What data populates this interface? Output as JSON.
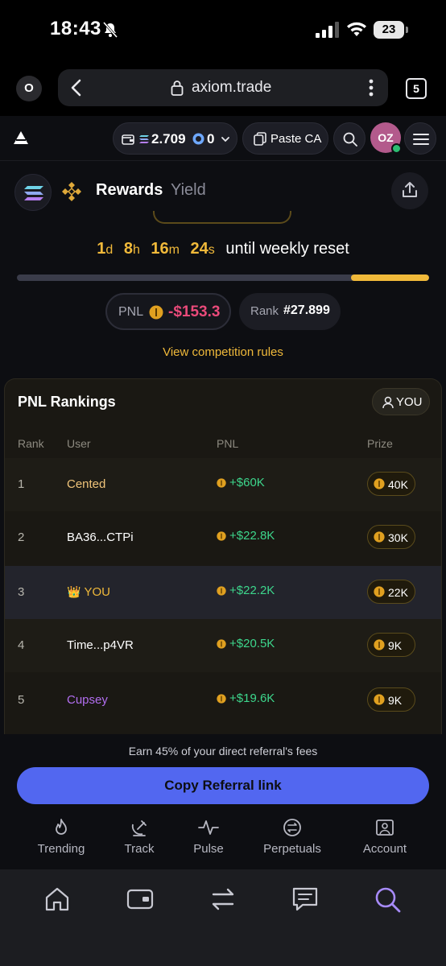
{
  "status": {
    "time": "18:43",
    "battery": "23"
  },
  "browser": {
    "left_badge": "O",
    "url": "axiom.trade",
    "tab_count": "5"
  },
  "header": {
    "sol_balance": "2.709",
    "token_balance": "0",
    "paste_label": "Paste CA",
    "avatar_initials": "OZ"
  },
  "rewards": {
    "tab_active": "Rewards",
    "tab_inactive": "Yield"
  },
  "countdown": {
    "days": "1",
    "days_unit": "d",
    "hours": "8",
    "hours_unit": "h",
    "minutes": "16",
    "minutes_unit": "m",
    "seconds": "24",
    "seconds_unit": "s",
    "suffix": "until weekly reset",
    "progress": 0.19
  },
  "stats": {
    "pnl_label": "PNL",
    "pnl_value": "-$153.3",
    "rank_label": "Rank",
    "rank_value": "#27.899"
  },
  "rules_link": "View competition rules",
  "rankings": {
    "title": "PNL Rankings",
    "you_button": "YOU",
    "columns": [
      "Rank",
      "User",
      "PNL",
      "Prize"
    ],
    "rows": [
      {
        "rank": "1",
        "user": "Cented",
        "pnl": "+$60K",
        "prize": "40K",
        "user_color": "#f0c47a"
      },
      {
        "rank": "2",
        "user": "BA36...CTPi",
        "pnl": "+$22.8K",
        "prize": "30K",
        "user_color": "#ffffff"
      },
      {
        "rank": "3",
        "user": "YOU",
        "pnl": "+$22.2K",
        "prize": "22K",
        "user_color": "#f0b93a",
        "crown": "👑"
      },
      {
        "rank": "4",
        "user": "Time...p4VR",
        "pnl": "+$20.5K",
        "prize": "9K",
        "user_color": "#ffffff"
      },
      {
        "rank": "5",
        "user": "Cupsey",
        "pnl": "+$19.6K",
        "prize": "9K",
        "user_color": "#b26ef0"
      }
    ]
  },
  "referral": {
    "note": "Earn 45% of your direct referral's fees",
    "button": "Copy Referral link"
  },
  "nav": {
    "trending": "Trending",
    "track": "Track",
    "pulse": "Pulse",
    "perpetuals": "Perpetuals",
    "account": "Account"
  },
  "colors": {
    "accent_gold": "#f0b93a",
    "negative": "#ea4a7a",
    "positive": "#3dd68c",
    "cta": "#5267f0"
  }
}
